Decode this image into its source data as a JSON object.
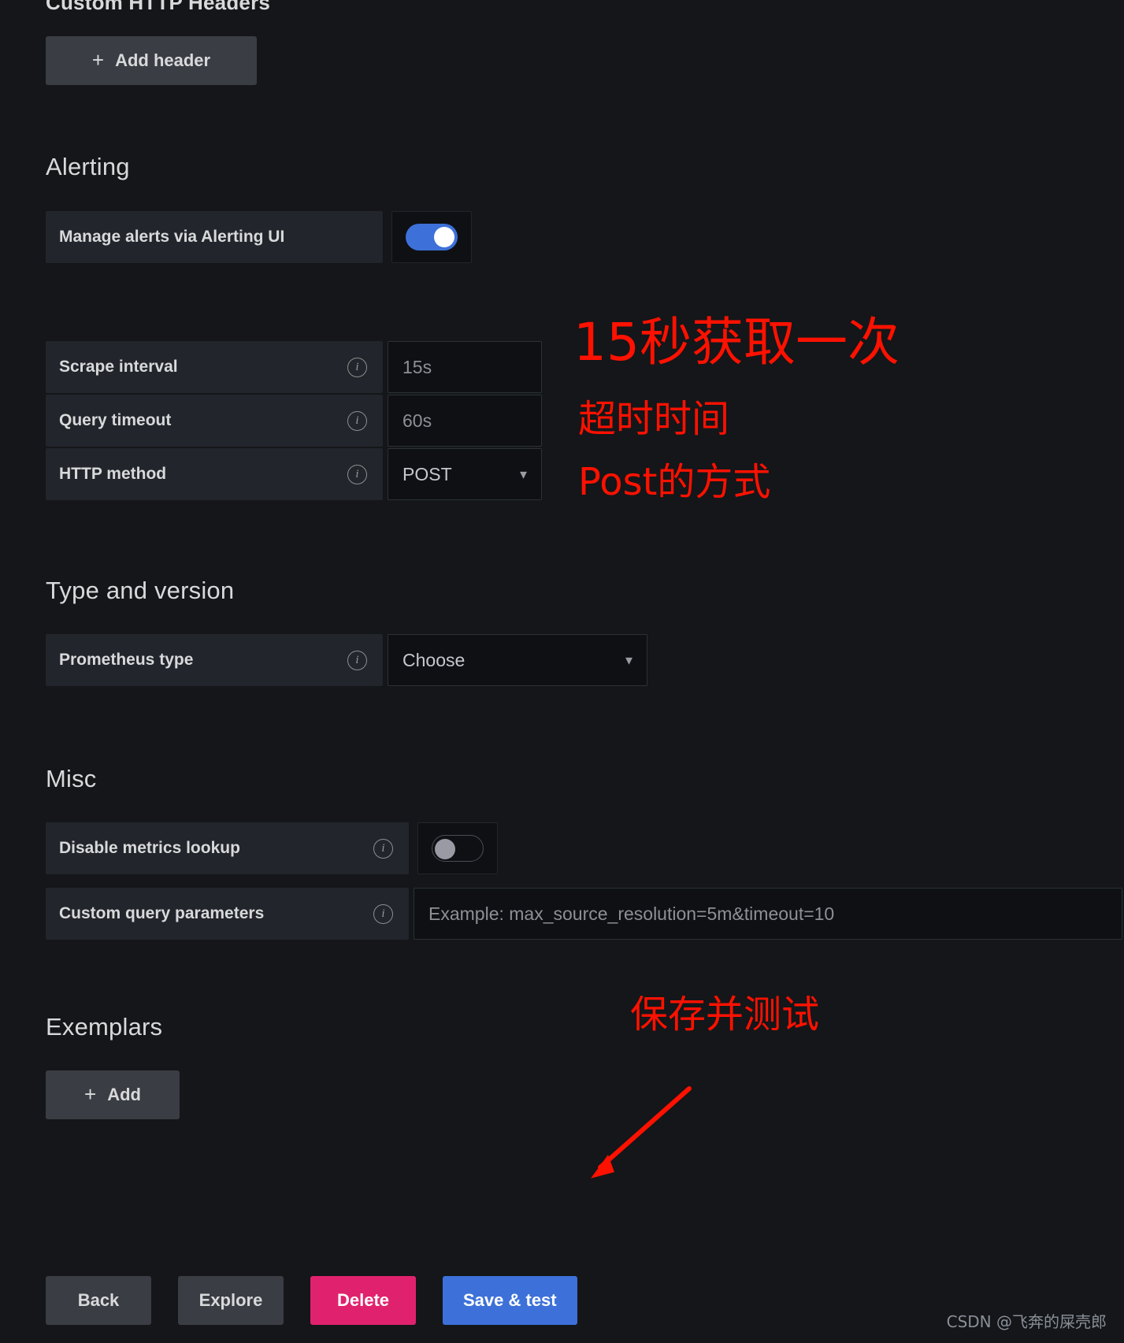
{
  "page": {
    "cut_off_heading": "Custom HTTP Headers",
    "background_color": "#141619"
  },
  "custom_http_headers": {
    "add_header_label": "Add header",
    "plus": "+"
  },
  "alerting": {
    "heading": "Alerting",
    "manage_alerts_label": "Manage alerts via Alerting UI",
    "manage_alerts_state": "on"
  },
  "intervals": {
    "rows": [
      {
        "label": "Scrape interval",
        "value": "15s",
        "kind": "text"
      },
      {
        "label": "Query timeout",
        "value": "60s",
        "kind": "text"
      },
      {
        "label": "HTTP method",
        "value": "POST",
        "kind": "select"
      }
    ]
  },
  "type_and_version": {
    "heading": "Type and version",
    "prometheus_type_label": "Prometheus type",
    "prometheus_type_value": "Choose"
  },
  "misc": {
    "heading": "Misc",
    "disable_metrics_lookup_label": "Disable metrics lookup",
    "disable_metrics_lookup_state": "off",
    "custom_query_parameters_label": "Custom query parameters",
    "custom_query_parameters_placeholder": "Example: max_source_resolution=5m&timeout=10"
  },
  "exemplars": {
    "heading": "Exemplars",
    "add_label": "Add",
    "plus": "+"
  },
  "footer": {
    "back_label": "Back",
    "explore_label": "Explore",
    "delete_label": "Delete",
    "save_test_label": "Save & test",
    "delete_color": "#e0226e",
    "save_color": "#3d71d9"
  },
  "annotations": {
    "color": "#ff1100",
    "scrape": "15秒获取一次",
    "timeout": "超时时间",
    "method": "Post的方式",
    "save": "保存并测试"
  },
  "watermark": {
    "text": "CSDN @飞奔的屎壳郎"
  }
}
